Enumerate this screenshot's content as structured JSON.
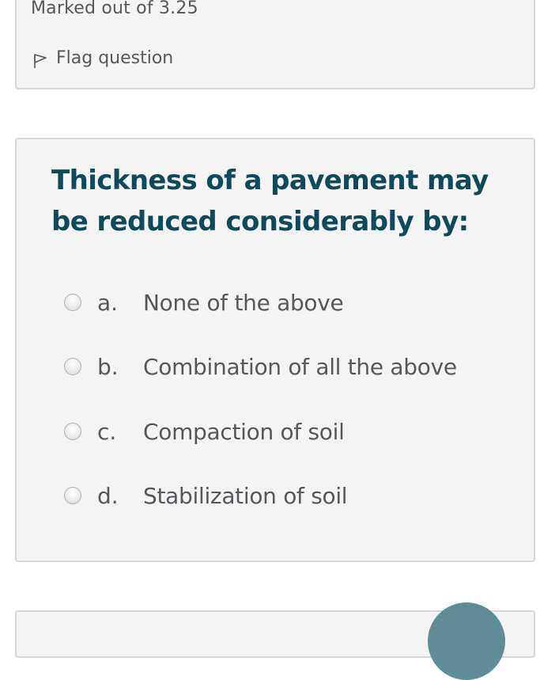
{
  "previous_question": {
    "marks_text": "Marked out of 3.25",
    "flag_label": "Flag question"
  },
  "question": {
    "text": "Thickness of a pavement may be reduced considerably by:",
    "answers": [
      {
        "letter": "a.",
        "text": "None of the above",
        "selected": false
      },
      {
        "letter": "b.",
        "text": "Combination of all the above",
        "selected": false
      },
      {
        "letter": "c.",
        "text": "Compaction of soil",
        "selected": false
      },
      {
        "letter": "d.",
        "text": "Stabilization of soil",
        "selected": false
      }
    ]
  },
  "colors": {
    "question_text": "#0e4a5a",
    "card_background": "#f4f4f4",
    "card_border": "#d8d8d8",
    "body_text": "#555a60",
    "floating_button": "#5e8d96"
  },
  "icons": {
    "flag": "flag-outline-icon",
    "radio": "radio-unchecked-icon"
  }
}
